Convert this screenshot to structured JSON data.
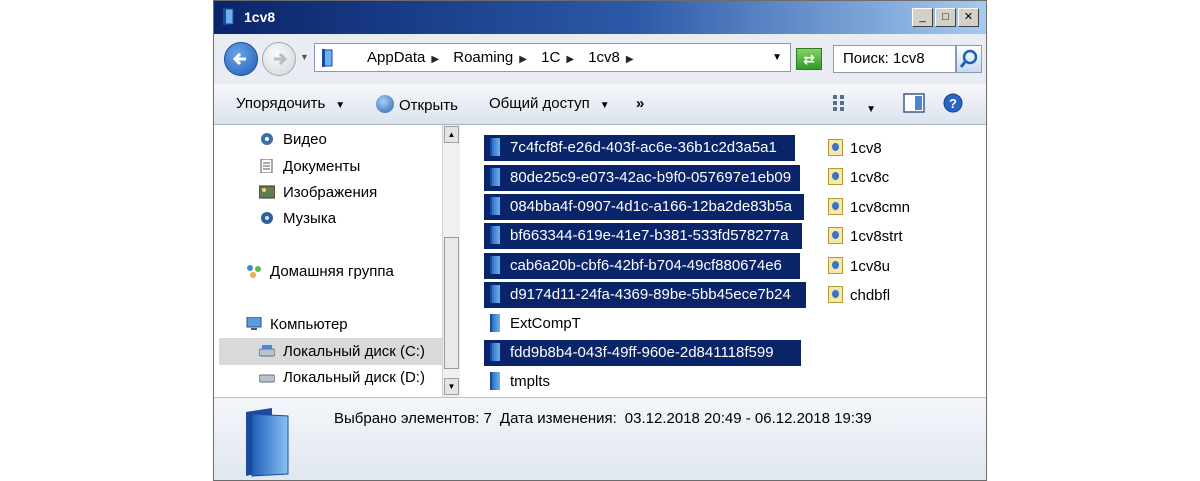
{
  "window": {
    "title": "1cv8"
  },
  "title_buttons": {
    "minimize": "_",
    "maximize": "□",
    "close": "✕"
  },
  "address": {
    "crumbs": [
      "AppData",
      "Roaming",
      "1C",
      "1cv8"
    ],
    "dropdown": "▼"
  },
  "refresh_icon": "refresh-icon",
  "search": {
    "value": "Поиск: 1cv8"
  },
  "toolbar": {
    "organize": "Упорядочить",
    "open": "Открыть",
    "share": "Общий доступ",
    "more": "»",
    "dd": "▼"
  },
  "navpane": {
    "items": [
      {
        "label": "Видео",
        "icon": "video-library-icon"
      },
      {
        "label": "Документы",
        "icon": "documents-library-icon"
      },
      {
        "label": "Изображения",
        "icon": "pictures-library-icon"
      },
      {
        "label": "Музыка",
        "icon": "music-library-icon"
      },
      {
        "label": "Домашняя группа",
        "icon": "homegroup-icon"
      },
      {
        "label": "Компьютер",
        "icon": "computer-icon"
      },
      {
        "label": "Локальный диск (C:)",
        "icon": "drive-icon"
      },
      {
        "label": "Локальный диск (D:)",
        "icon": "drive-icon"
      }
    ],
    "selected": "Локальный диск (C:)"
  },
  "files": [
    {
      "name": "7c4fcf8f-e26d-403f-ac6e-36b1c2d3a5a1",
      "selected": true
    },
    {
      "name": "80de25c9-e073-42ac-b9f0-057697e1eb09",
      "selected": true
    },
    {
      "name": "084bba4f-0907-4d1c-a166-12ba2de83b5a",
      "selected": true
    },
    {
      "name": "bf663344-619e-41e7-b381-533fd578277a",
      "selected": true
    },
    {
      "name": "cab6a20b-cbf6-42bf-b704-49cf880674e6",
      "selected": true
    },
    {
      "name": "d9174d11-24fa-4369-89be-5bb45ece7b24",
      "selected": true
    },
    {
      "name": "ExtCompT",
      "selected": false
    },
    {
      "name": "fdd9b8b4-043f-49ff-960e-2d841118f599",
      "selected": true
    },
    {
      "name": "tmplts",
      "selected": false
    }
  ],
  "log_files": [
    "1cv8",
    "1cv8c",
    "1cv8cmn",
    "1cv8strt",
    "1cv8u",
    "chdbfl"
  ],
  "details": {
    "selected_count": "Выбрано элементов: 7",
    "modified_label": "Дата изменения:",
    "modified_range": "03.12.2018 20:49 - 06.12.2018 19:39"
  }
}
